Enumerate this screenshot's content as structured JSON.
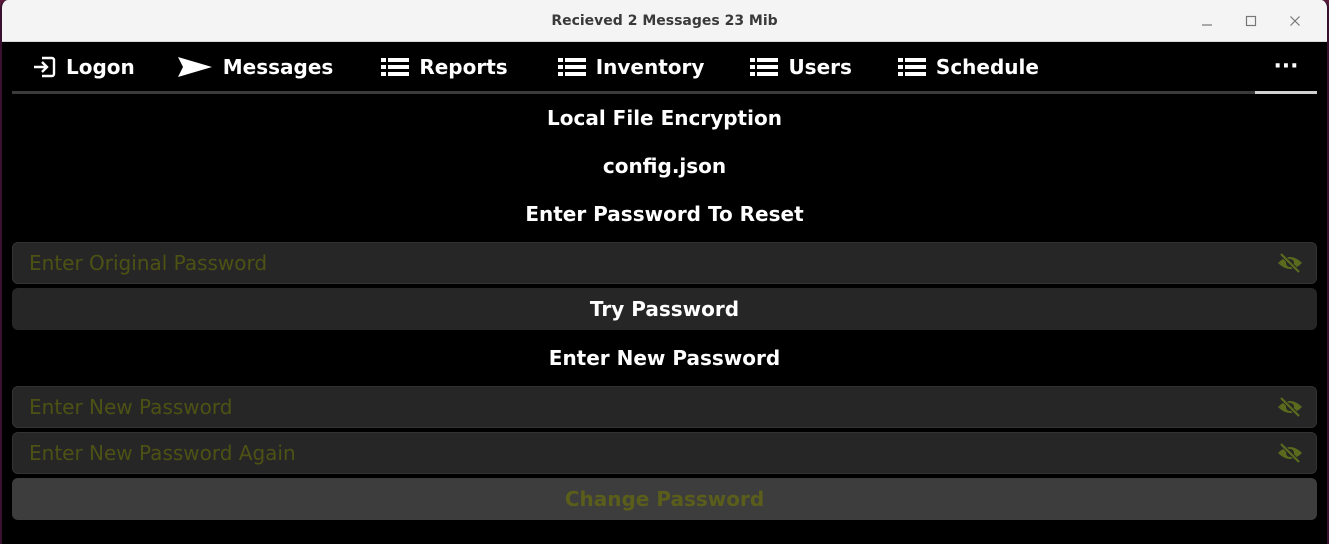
{
  "window": {
    "title": "Recieved 2 Messages  23 Mib",
    "controls": {
      "minimize": "–",
      "maximize": "□",
      "close": "×"
    }
  },
  "nav": {
    "items": [
      {
        "label": "Logon",
        "icon": "login-icon"
      },
      {
        "label": "Messages",
        "icon": "send-icon"
      },
      {
        "label": "Reports",
        "icon": "list-icon"
      },
      {
        "label": "Inventory",
        "icon": "list-icon"
      },
      {
        "label": "Users",
        "icon": "list-icon"
      },
      {
        "label": "Schedule",
        "icon": "list-icon"
      }
    ],
    "more": "···"
  },
  "main": {
    "heading": "Local File Encryption",
    "filename": "config.json",
    "reset_prompt": "Enter Password To Reset",
    "original_password_placeholder": "Enter Original Password",
    "try_button": "Try Password",
    "new_password_prompt": "Enter New Password",
    "new_password_placeholder": "Enter New Password",
    "new_password_again_placeholder": "Enter New Password Again",
    "change_button": "Change Password"
  },
  "colors": {
    "background": "#000000",
    "field": "#262626",
    "placeholder": "#4d5214",
    "eye_icon": "#5a6b1e",
    "disabled_button": "#3d3d3d"
  }
}
